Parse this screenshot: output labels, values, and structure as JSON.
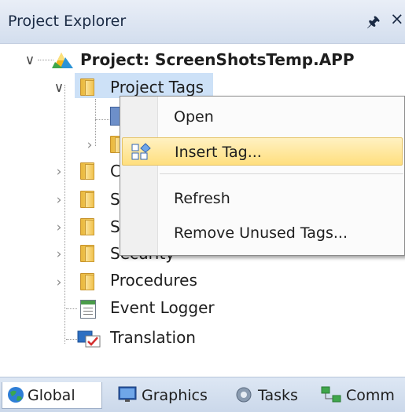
{
  "panel": {
    "title": "Project Explorer",
    "pin_glyph": "⍑",
    "close_glyph": "×"
  },
  "tree": {
    "root": "Project: ScreenShotsTemp.APP",
    "items": [
      {
        "label": "Project Tags",
        "state": "selected"
      },
      {
        "label": "C",
        "state": "partial"
      },
      {
        "label": "S",
        "state": "partial"
      },
      {
        "label": "S",
        "state": "partial"
      },
      {
        "label": "Security",
        "state": "partial"
      },
      {
        "label": "Procedures",
        "state": "collapsed"
      },
      {
        "label": "Event Logger",
        "state": "leaf"
      },
      {
        "label": "Translation",
        "state": "leaf"
      }
    ],
    "expand_glyph": "⌵",
    "collapse_glyph": "›",
    "expanded_glyph": "∨"
  },
  "context_menu": {
    "items": [
      {
        "label": "Open"
      },
      {
        "label": "Insert Tag...",
        "hover": true
      },
      {
        "label": "Refresh"
      },
      {
        "label": "Remove Unused Tags..."
      }
    ]
  },
  "tabs": [
    {
      "label": "Global",
      "icon": "globe-icon",
      "active": true
    },
    {
      "label": "Graphics",
      "icon": "monitor-icon"
    },
    {
      "label": "Tasks",
      "icon": "gear-icon"
    },
    {
      "label": "Comm",
      "icon": "network-icon"
    }
  ],
  "colors": {
    "accent": "#cde1f7",
    "menu_hover": "#ffdf7e",
    "titlebar": "#d3deee"
  }
}
